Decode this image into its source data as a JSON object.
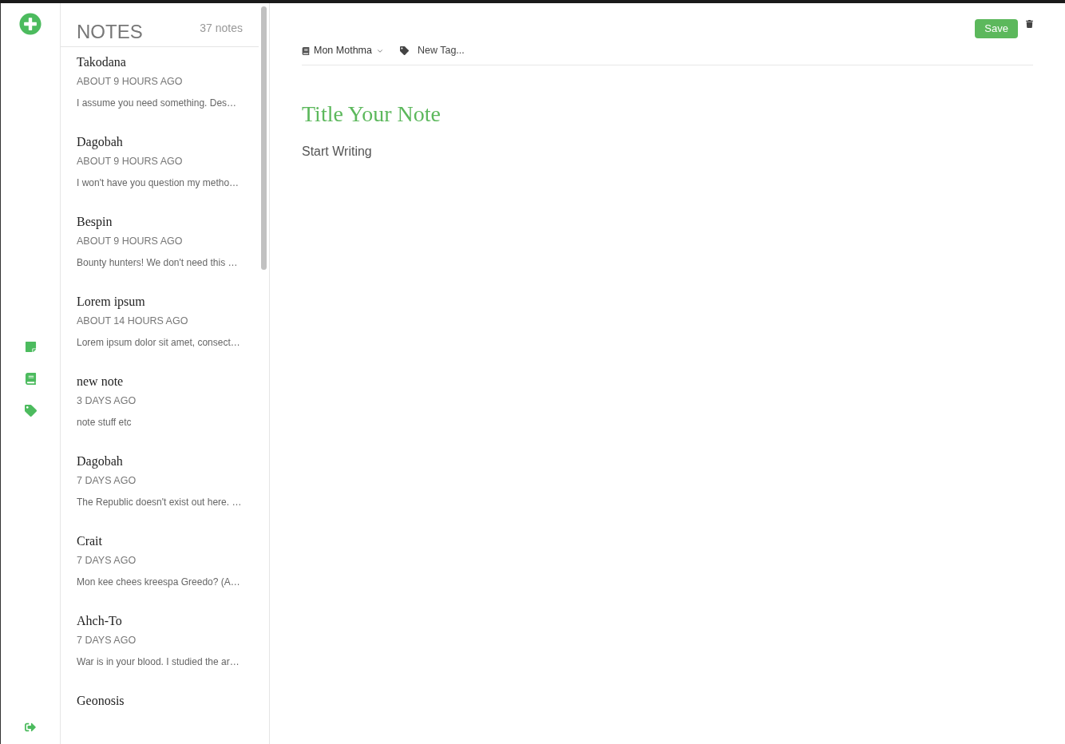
{
  "list_header": {
    "title": "NOTES",
    "count": "37 notes"
  },
  "notes": [
    {
      "title": "Takodana",
      "time": "ABOUT 9 HOURS AGO",
      "preview": "I assume you need something. Des…"
    },
    {
      "title": "Dagobah",
      "time": "ABOUT 9 HOURS AGO",
      "preview": "I won't have you question my metho…"
    },
    {
      "title": "Bespin",
      "time": "ABOUT 9 HOURS AGO",
      "preview": "Bounty hunters! We don't need this …"
    },
    {
      "title": "Lorem ipsum",
      "time": "ABOUT 14 HOURS AGO",
      "preview": "Lorem ipsum dolor sit amet, consect…"
    },
    {
      "title": "new note",
      "time": "3 DAYS AGO",
      "preview": "note stuff etc"
    },
    {
      "title": "Dagobah",
      "time": "7 DAYS AGO",
      "preview": "The Republic doesn't exist out here. …"
    },
    {
      "title": "Crait",
      "time": "7 DAYS AGO",
      "preview": "Mon kee chees kreespa Greedo? (A…"
    },
    {
      "title": "Ahch-To",
      "time": "7 DAYS AGO",
      "preview": "War is in your blood. I studied the ar…"
    },
    {
      "title": "Geonosis"
    }
  ],
  "editor": {
    "save": "Save",
    "notebook": "Mon Mothma",
    "tag_placeholder": "New Tag...",
    "title_placeholder": "Title Your Note",
    "body_placeholder": "Start Writing"
  }
}
